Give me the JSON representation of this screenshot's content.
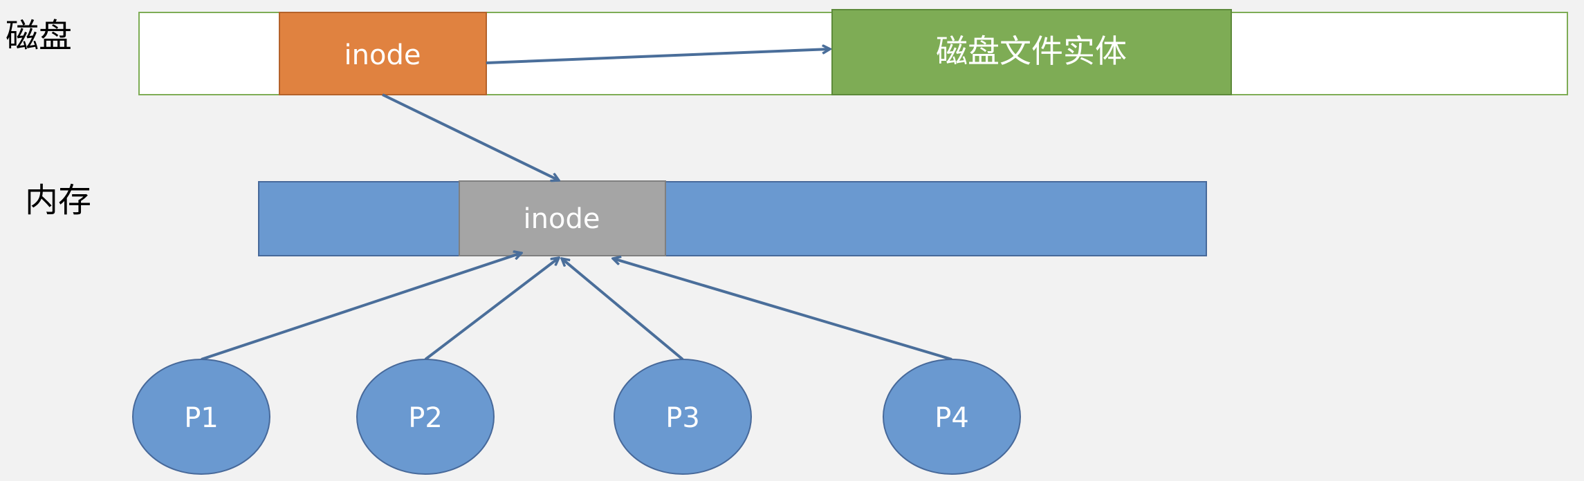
{
  "labels": {
    "disk": "磁盘",
    "memory": "内存"
  },
  "disk": {
    "inode": "inode",
    "file_entity": "磁盘文件实体"
  },
  "memory": {
    "inode": "inode"
  },
  "processes": [
    "P1",
    "P2",
    "P3",
    "P4"
  ],
  "colors": {
    "background": "#f2f2f2",
    "disk_bar_border": "#7eac55",
    "disk_inode_fill": "#e08240",
    "file_entity_fill": "#7eac55",
    "memory_bar_fill": "#6a99d0",
    "memory_inode_fill": "#a5a5a5",
    "process_fill": "#6a99d0",
    "arrow": "#4a6e9a"
  }
}
